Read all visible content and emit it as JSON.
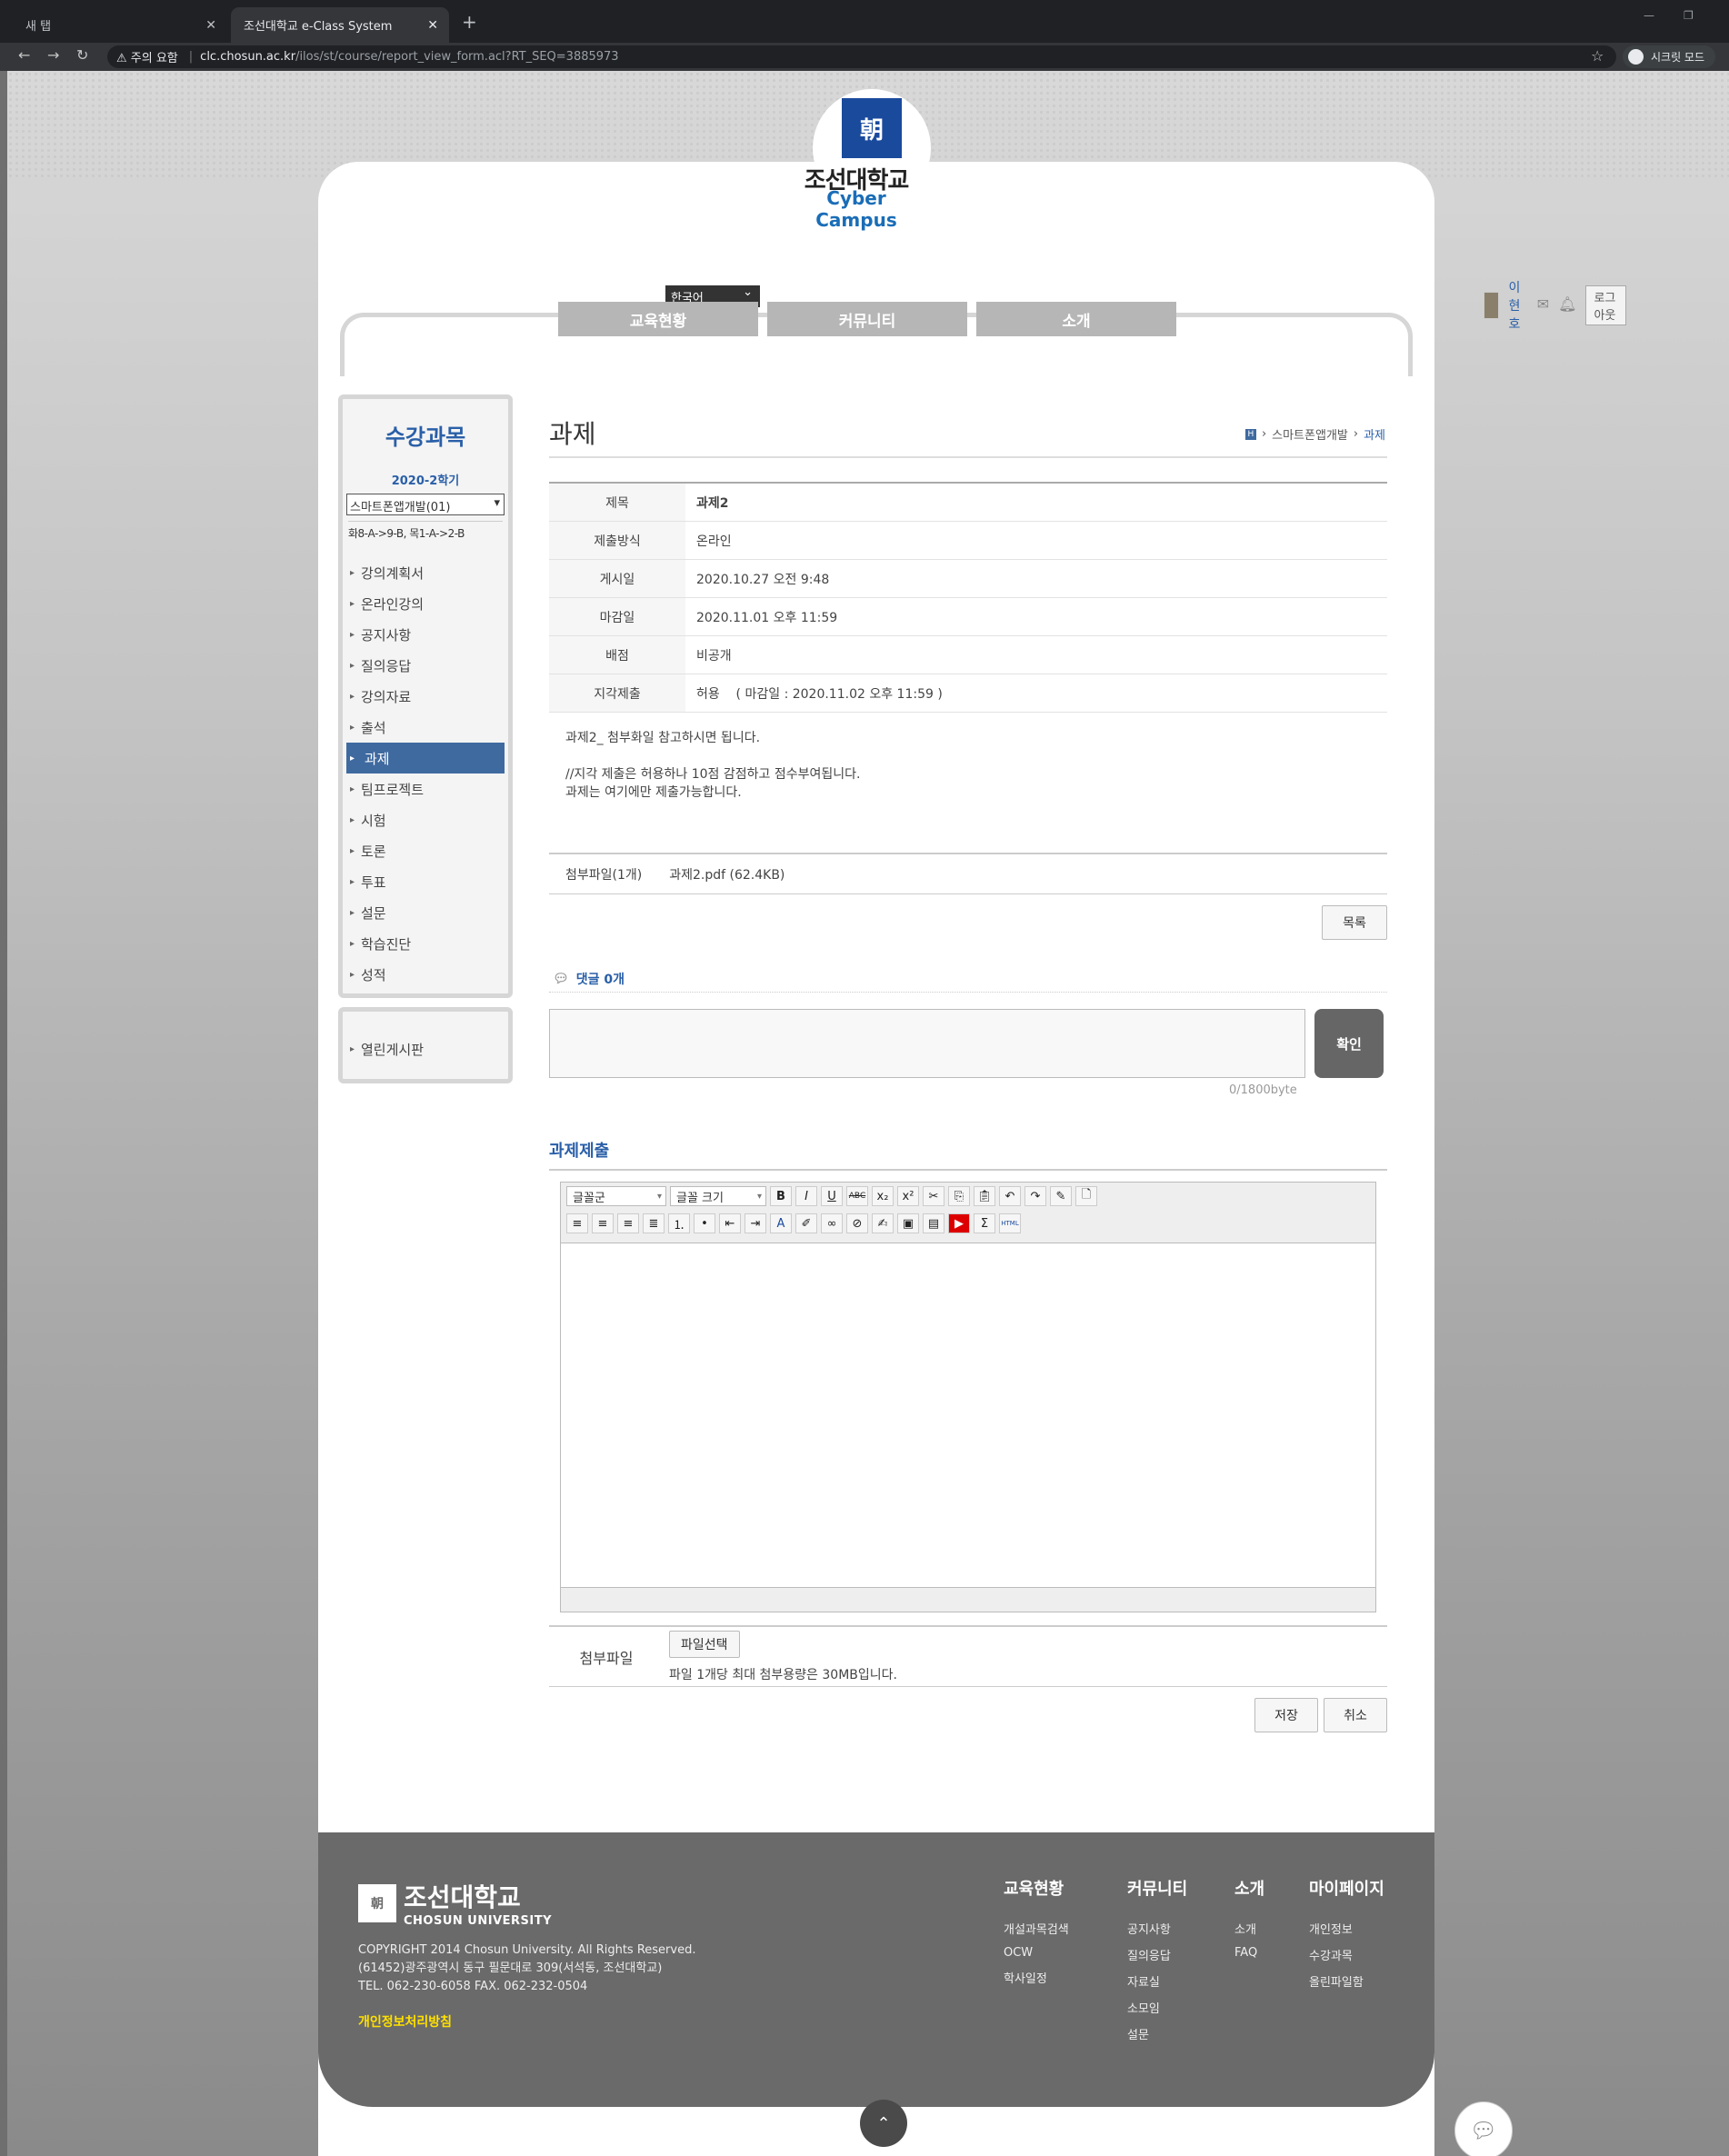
{
  "browser": {
    "tabs": [
      {
        "title": "새 탭"
      },
      {
        "title": "조선대학교 e-Class System"
      }
    ],
    "new_tab": "+",
    "security": "주의 요함",
    "url_host": "clc.chosun.ac.kr",
    "url_path": "/ilos/st/course/report_view_form.acl?RT_SEQ=3885973",
    "incognito": "시크릿 모드"
  },
  "header": {
    "language": "한국어",
    "logo_box": "朝",
    "logo_kr": "조선대학교",
    "logo_en": "Cyber Campus",
    "user_name": "이현호",
    "logout": "로그아웃",
    "gnb": [
      "교육현황",
      "커뮤니티",
      "소개"
    ]
  },
  "sidebar": {
    "title": "수강과목",
    "semester": "2020-2학기",
    "course": "스마트폰앱개발(01)",
    "time": "화8-A->9-B, 목1-A->2-B",
    "items": [
      {
        "label": "강의계획서"
      },
      {
        "label": "온라인강의"
      },
      {
        "label": "공지사항"
      },
      {
        "label": "질의응답"
      },
      {
        "label": "강의자료"
      },
      {
        "label": "출석"
      },
      {
        "label": "과제"
      },
      {
        "label": "팀프로젝트"
      },
      {
        "label": "시험"
      },
      {
        "label": "토론"
      },
      {
        "label": "투표"
      },
      {
        "label": "설문"
      },
      {
        "label": "학습진단"
      },
      {
        "label": "성적"
      }
    ],
    "active_index": 6,
    "extra": "열린게시판"
  },
  "main": {
    "title": "과제",
    "breadcrumb": {
      "home": "H",
      "course": "스마트폰앱개발",
      "current": "과제"
    },
    "info": [
      {
        "label": "제목",
        "value": "과제2"
      },
      {
        "label": "제출방식",
        "value": "온라인"
      },
      {
        "label": "게시일",
        "value": "2020.10.27 오전 9:48"
      },
      {
        "label": "마감일",
        "value": "2020.11.01 오후 11:59"
      },
      {
        "label": "배점",
        "value": "비공개"
      },
      {
        "label": "지각제출",
        "value": "허용    ( 마감일 : 2020.11.02 오후 11:59 )"
      }
    ],
    "body_lines": [
      "과제2_ 첨부화일 참고하시면 됩니다.",
      "",
      "//지각 제출은 허용하나 10점 감점하고 점수부여됩니다.",
      "과제는 여기에만 제출가능합니다."
    ],
    "attach_label": "첨부파일(1개)",
    "attach_file": "과제2.pdf (62.4KB)",
    "list_button": "목록",
    "comments_label": "댓글 0개",
    "comment_submit": "확인",
    "comment_count": "0/1800byte",
    "submit_title": "과제제출",
    "editor": {
      "font": "글꼴군",
      "size": "글꼴 크기"
    },
    "file_label": "첨부파일",
    "file_button": "파일선택",
    "file_help": "파일 1개당 최대 첨부용량은 30MB입니다.",
    "save": "저장",
    "cancel": "취소"
  },
  "footer": {
    "logo_kr": "조선대학교",
    "logo_en": "CHOSUN UNIVERSITY",
    "copyright": "COPYRIGHT 2014 Chosun University. All Rights Reserved.",
    "address": "(61452)광주광역시 동구 필문대로 309(서석동, 조선대학교)",
    "tel": "TEL. 062-230-6058 FAX. 062-232-0504",
    "policy": "개인정보처리방침",
    "cols": [
      {
        "title": "교육현황",
        "links": [
          "개설과목검색",
          "OCW",
          "학사일정"
        ]
      },
      {
        "title": "커뮤니티",
        "links": [
          "공지사항",
          "질의응답",
          "자료실",
          "소모임",
          "설문"
        ]
      },
      {
        "title": "소개",
        "links": [
          "소개",
          "FAQ"
        ]
      },
      {
        "title": "마이페이지",
        "links": [
          "개인정보",
          "수강과목",
          "올린파일함"
        ]
      }
    ]
  }
}
